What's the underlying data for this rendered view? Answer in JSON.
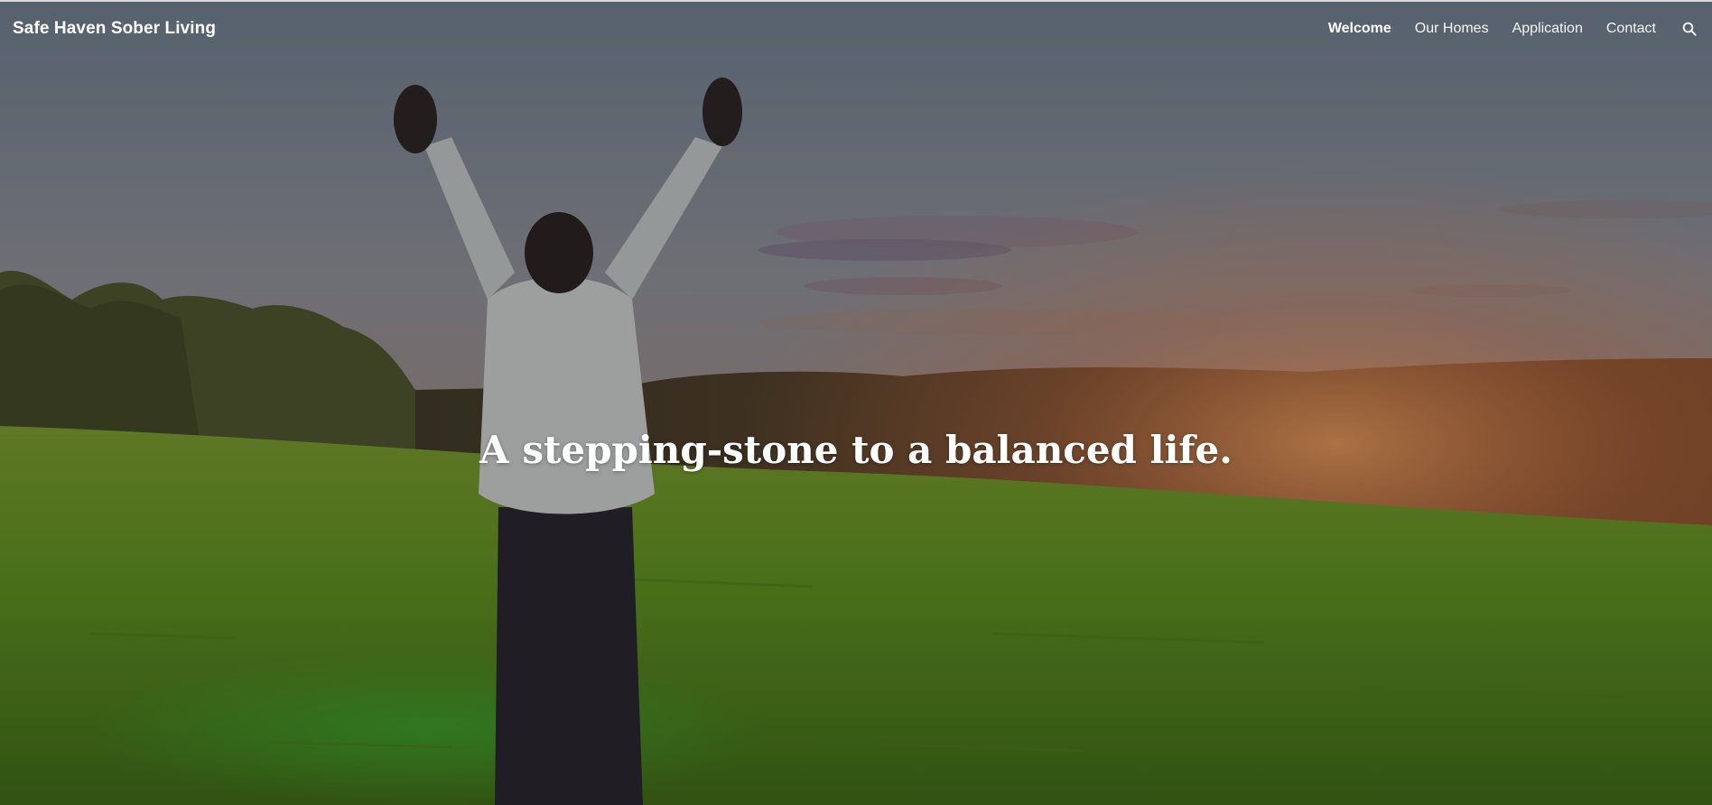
{
  "site": {
    "title": "Safe Haven Sober Living"
  },
  "nav": {
    "items": [
      {
        "label": "Welcome",
        "active": true
      },
      {
        "label": "Our Homes",
        "active": false
      },
      {
        "label": "Application",
        "active": false
      },
      {
        "label": "Contact",
        "active": false
      }
    ],
    "search_icon": "search-icon"
  },
  "hero": {
    "headline": "A stepping-stone to a balanced life.",
    "image": "person-with-raised-arms-in-sunlit-field"
  },
  "colors": {
    "text": "#ffffff",
    "sky": "#8a8f98",
    "grass": "#5a8a1e",
    "sunset": "#d07a3a"
  }
}
